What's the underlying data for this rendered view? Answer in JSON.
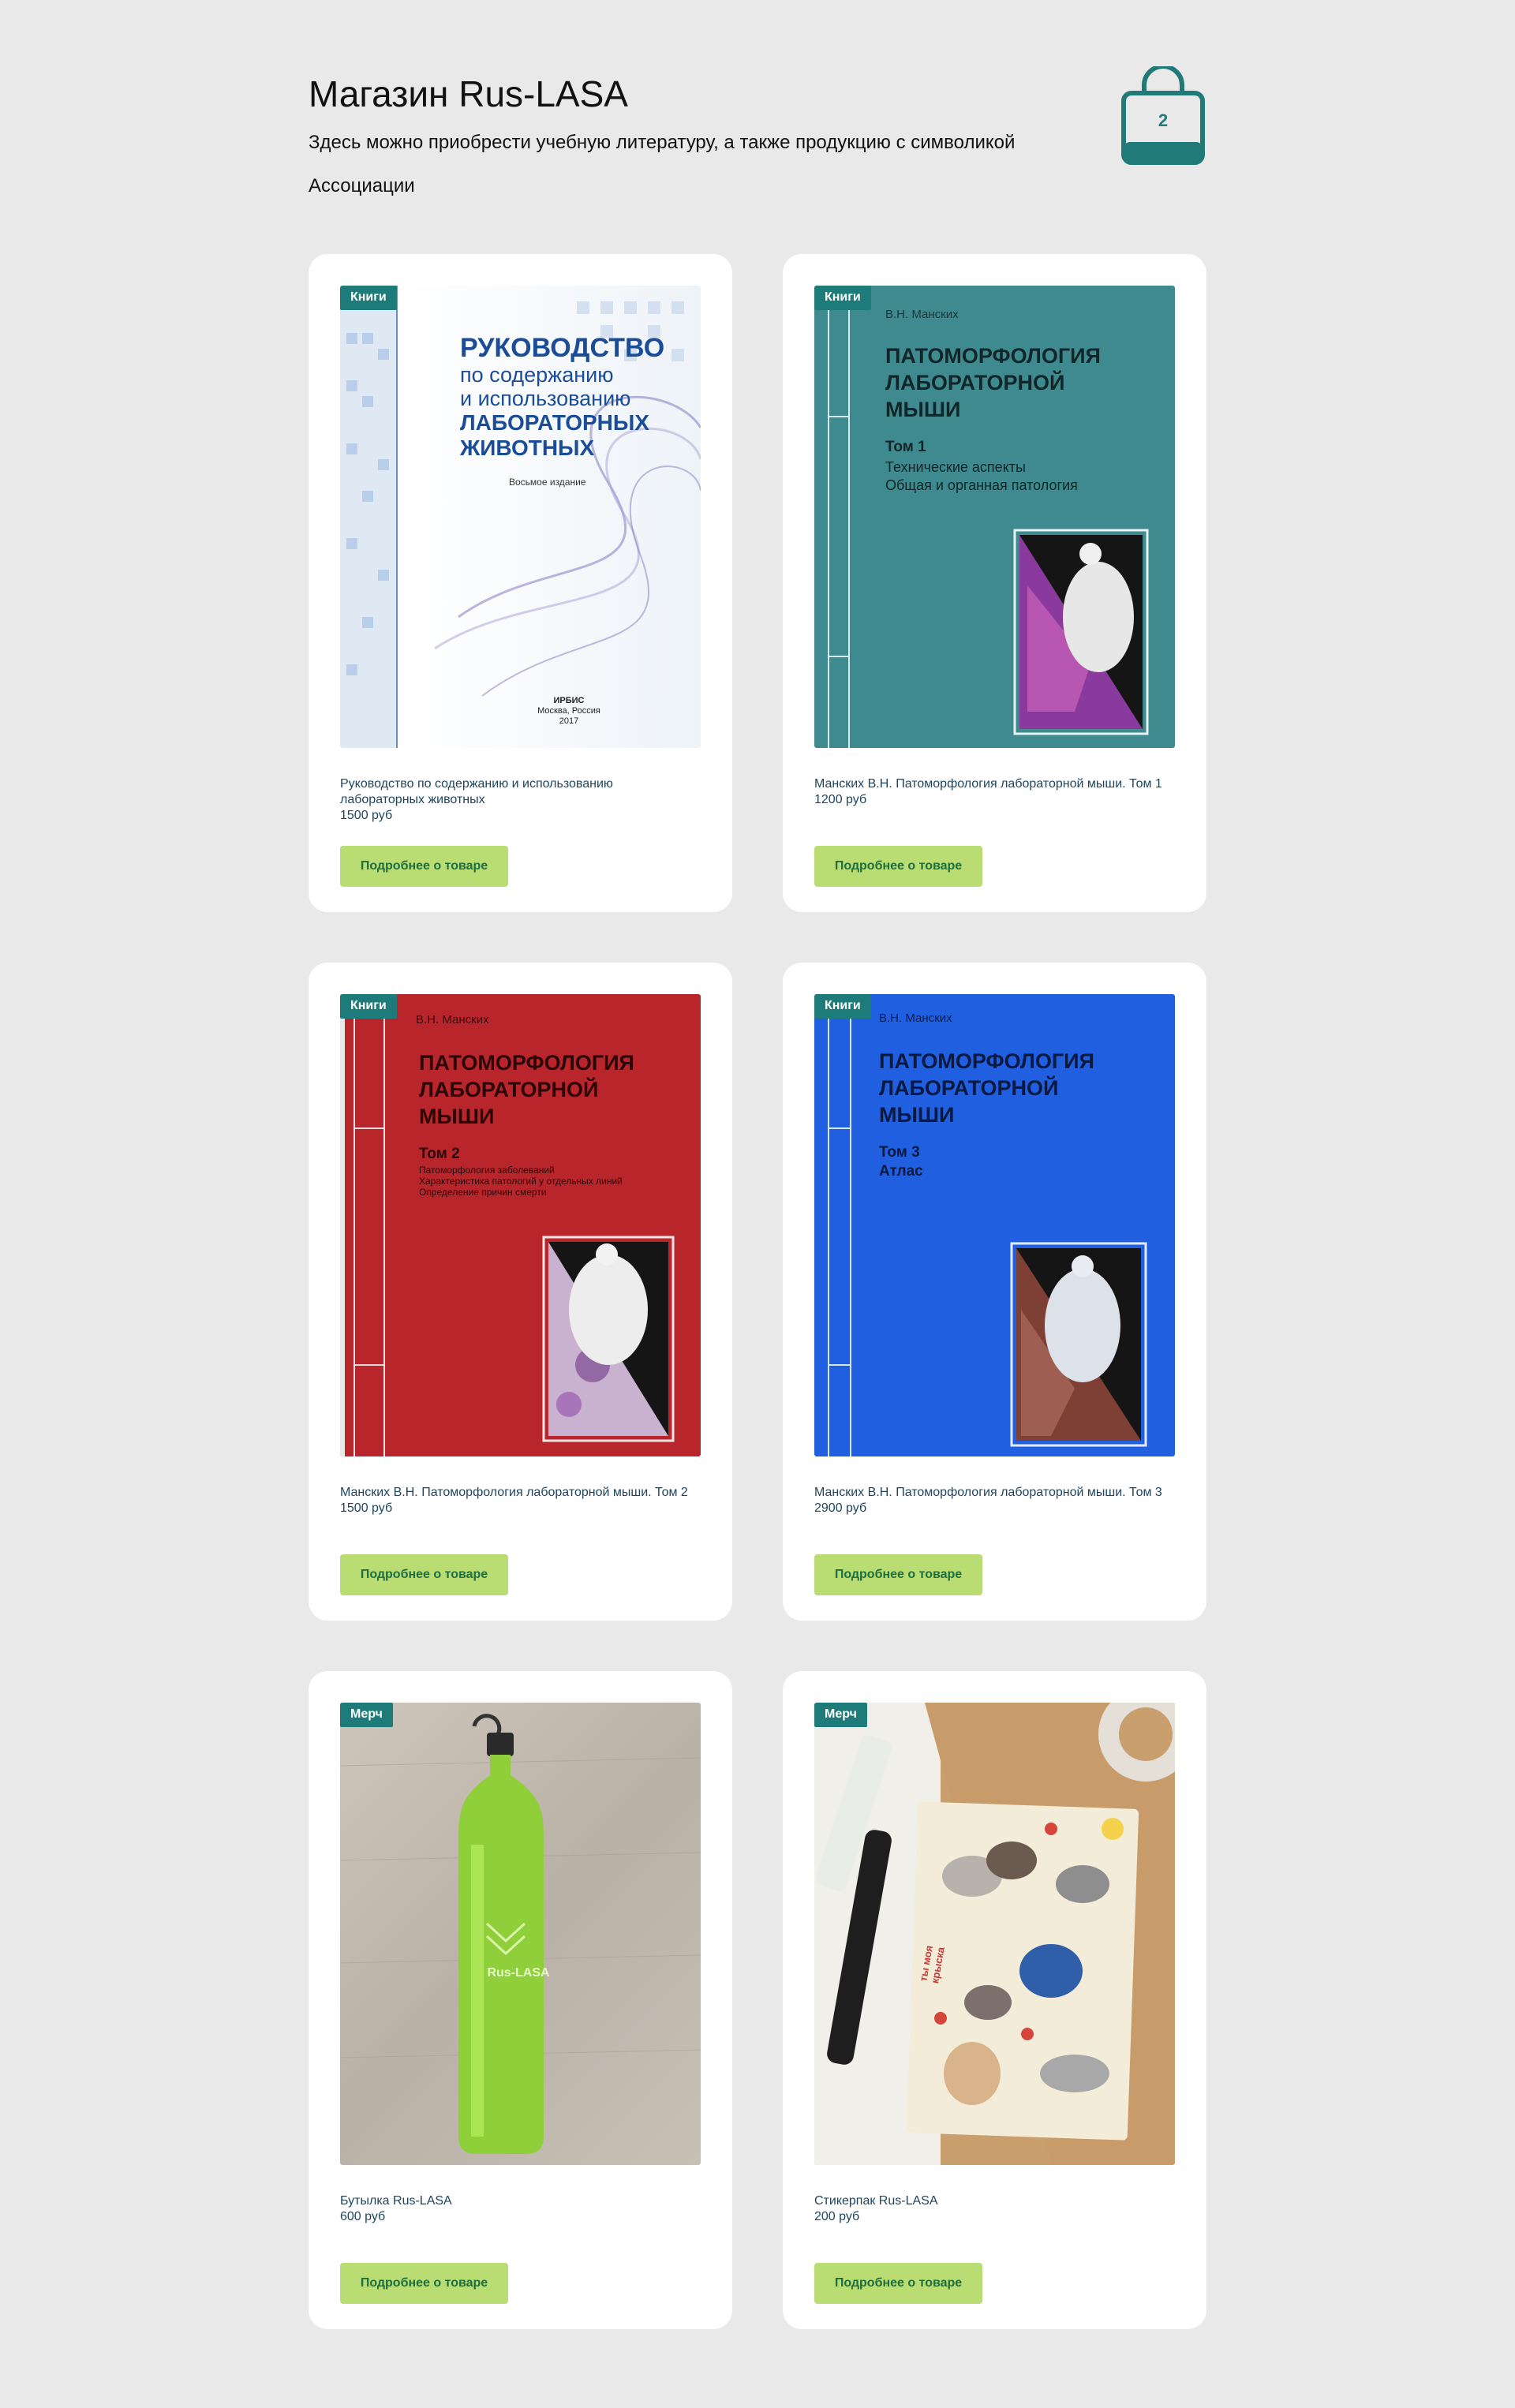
{
  "header": {
    "title": "Магазин Rus-LASA",
    "subtitle": "Здесь можно приобрести учебную литературу, а также продукцию с символикой Ассоциации"
  },
  "cart": {
    "count": "2",
    "icon": "shopping-bag-icon",
    "color": "#1f7a78"
  },
  "products": [
    {
      "badge": "Книги",
      "name": "Руководство по содержанию и использованию лабораторных животных",
      "price": "1500 руб",
      "button": "Подробнее о товаре",
      "cover": {
        "lines": [
          "РУКОВОДСТВО",
          "по содержанию",
          "и использованию",
          "ЛАБОРАТОРНЫХ",
          "ЖИВОТНЫХ"
        ],
        "edition": "Восьмое издание",
        "publisher": "ИРБИС",
        "city": "Москва, Россия",
        "year": "2017"
      }
    },
    {
      "badge": "Книги",
      "name": "Манских В.Н. Патоморфология лабораторной мыши. Том 1",
      "price": "1200 руб",
      "button": "Подробнее о товаре",
      "cover": {
        "author": "В.Н. Манских",
        "title_lines": [
          "ПАТОМОРФОЛОГИЯ",
          "ЛАБОРАТОРНОЙ",
          "МЫШИ"
        ],
        "volume": "Том 1",
        "sub_lines": [
          "Технические аспекты",
          "Общая и органная патология"
        ]
      }
    },
    {
      "badge": "Книги",
      "name": "Манских В.Н. Патоморфология лабораторной мыши. Том 2",
      "price": "1500 руб",
      "button": "Подробнее о товаре",
      "cover": {
        "author": "В.Н. Манских",
        "title_lines": [
          "ПАТОМОРФОЛОГИЯ",
          "ЛАБОРАТОРНОЙ",
          "МЫШИ"
        ],
        "volume": "Том 2",
        "sub_lines": [
          "Патоморфология заболеваний",
          "Характеристика патологий у отдельных линий",
          "Определение причин смерти"
        ]
      }
    },
    {
      "badge": "Книги",
      "name": "Манских В.Н. Патоморфология лабораторной мыши. Том 3",
      "price": "2900 руб",
      "button": "Подробнее о товаре",
      "cover": {
        "author": "В.Н. Манских",
        "title_lines": [
          "ПАТОМОРФОЛОГИЯ",
          "ЛАБОРАТОРНОЙ",
          "МЫШИ"
        ],
        "volume": "Том 3",
        "sub_lines": [
          "Атлас"
        ]
      }
    },
    {
      "badge": "Мерч",
      "name": "Бутылка Rus-LASA",
      "price": "600 руб",
      "button": "Подробнее о товаре",
      "cover": {
        "logo_text": "Rus-LASA"
      }
    },
    {
      "badge": "Мерч",
      "name": "Стикерпак Rus-LASA",
      "price": "200 руб",
      "button": "Подробнее о товаре",
      "cover": {
        "sticker_text": "ты моя крыска"
      }
    }
  ],
  "colors": {
    "badge": "#1d7c7a",
    "button_bg": "#b9dc73",
    "button_text": "#1e6f3f",
    "vol1": "#3f8a8e",
    "vol2": "#b8262c",
    "vol3": "#1f5fe0",
    "bottle": "#8fd03a"
  }
}
